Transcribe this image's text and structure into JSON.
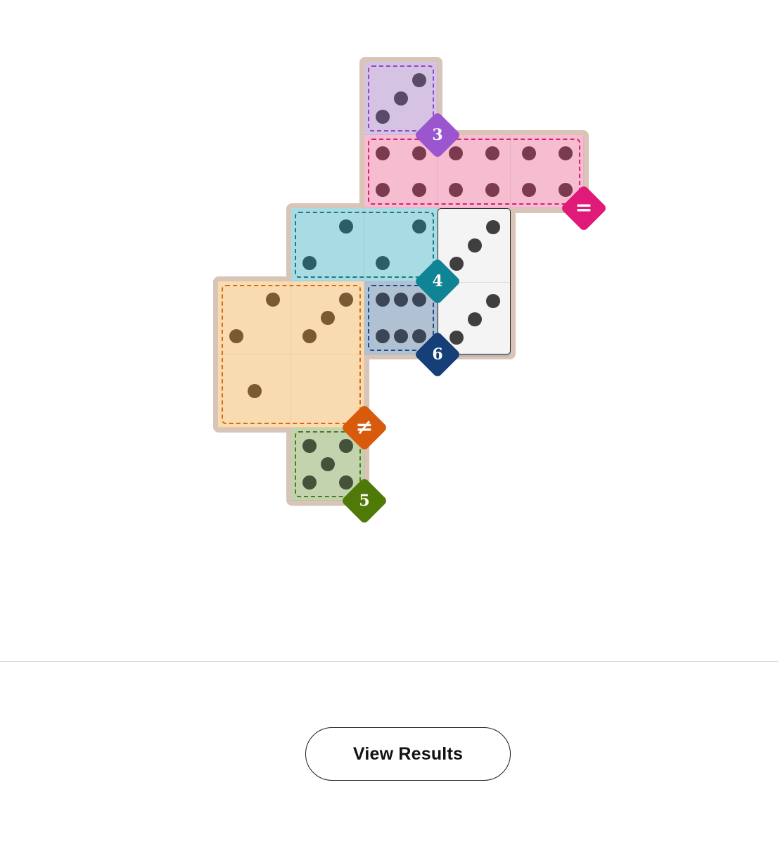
{
  "colors": {
    "board": "#d9c4b8",
    "domino_face": "#f4f4f4",
    "domino_pip": "#3f3f3f"
  },
  "board_cells": [
    [
      0,
      2
    ],
    [
      1,
      2
    ],
    [
      1,
      3
    ],
    [
      1,
      4
    ],
    [
      2,
      1
    ],
    [
      2,
      2
    ],
    [
      2,
      3
    ],
    [
      3,
      0
    ],
    [
      3,
      1
    ],
    [
      3,
      2
    ],
    [
      3,
      3
    ],
    [
      4,
      0
    ],
    [
      4,
      1
    ],
    [
      5,
      1
    ]
  ],
  "regions": [
    {
      "name": "purple",
      "fill": "#d6c3e4",
      "border": "#9147c8",
      "pip": "#5a4a6a",
      "cells": [
        [
          0,
          2
        ]
      ],
      "badge": {
        "label": "3",
        "color": "#9a55cf"
      }
    },
    {
      "name": "pink",
      "fill": "#f6bcd0",
      "border": "#d91f76",
      "pip": "#7c3a4e",
      "cells": [
        [
          1,
          2
        ],
        [
          1,
          3
        ],
        [
          1,
          4
        ]
      ],
      "badge": {
        "label": "=",
        "color": "#df1a78"
      }
    },
    {
      "name": "teal",
      "fill": "#a9dbe2",
      "border": "#1a7a8a",
      "pip": "#2b5e66",
      "cells": [
        [
          2,
          1
        ],
        [
          2,
          2
        ]
      ],
      "badge": {
        "label": "4",
        "color": "#0e8494"
      }
    },
    {
      "name": "navy",
      "fill": "#b1c1d4",
      "border": "#1d4b8a",
      "pip": "#3a4556",
      "cells": [
        [
          3,
          2
        ]
      ],
      "badge": {
        "label": "6",
        "color": "#163f78"
      }
    },
    {
      "name": "orange",
      "fill": "#f8dbb0",
      "border": "#d86a12",
      "pip": "#7a5a32",
      "cells": [
        [
          3,
          0
        ],
        [
          3,
          1
        ],
        [
          4,
          0
        ],
        [
          4,
          1
        ]
      ],
      "badge": {
        "label": "≠",
        "color": "#d85a0c"
      }
    },
    {
      "name": "green",
      "fill": "#c3d3ad",
      "border": "#4f7a22",
      "pip": "#44523a",
      "cells": [
        [
          5,
          1
        ]
      ],
      "badge": {
        "label": "5",
        "color": "#4f7a08"
      }
    }
  ],
  "dominoes": [
    {
      "cells": [
        [
          2,
          3
        ],
        [
          3,
          3
        ]
      ],
      "pips": [
        3,
        3
      ]
    }
  ],
  "cell_pips": [
    {
      "cell": [
        0,
        2
      ],
      "pips": 3
    },
    {
      "cell": [
        1,
        2
      ],
      "pips": 4
    },
    {
      "cell": [
        1,
        3
      ],
      "pips": 4
    },
    {
      "cell": [
        1,
        4
      ],
      "pips": 4
    },
    {
      "cell": [
        2,
        1
      ],
      "pips": 2
    },
    {
      "cell": [
        2,
        2
      ],
      "pips": 2
    },
    {
      "cell": [
        3,
        0
      ],
      "pips": 2
    },
    {
      "cell": [
        3,
        1
      ],
      "pips": 3
    },
    {
      "cell": [
        3,
        2
      ],
      "pips": 6
    },
    {
      "cell": [
        4,
        0
      ],
      "pips": 1
    },
    {
      "cell": [
        4,
        1
      ],
      "pips": 0
    },
    {
      "cell": [
        5,
        1
      ],
      "pips": 5
    }
  ],
  "view_results_label": "View Results"
}
